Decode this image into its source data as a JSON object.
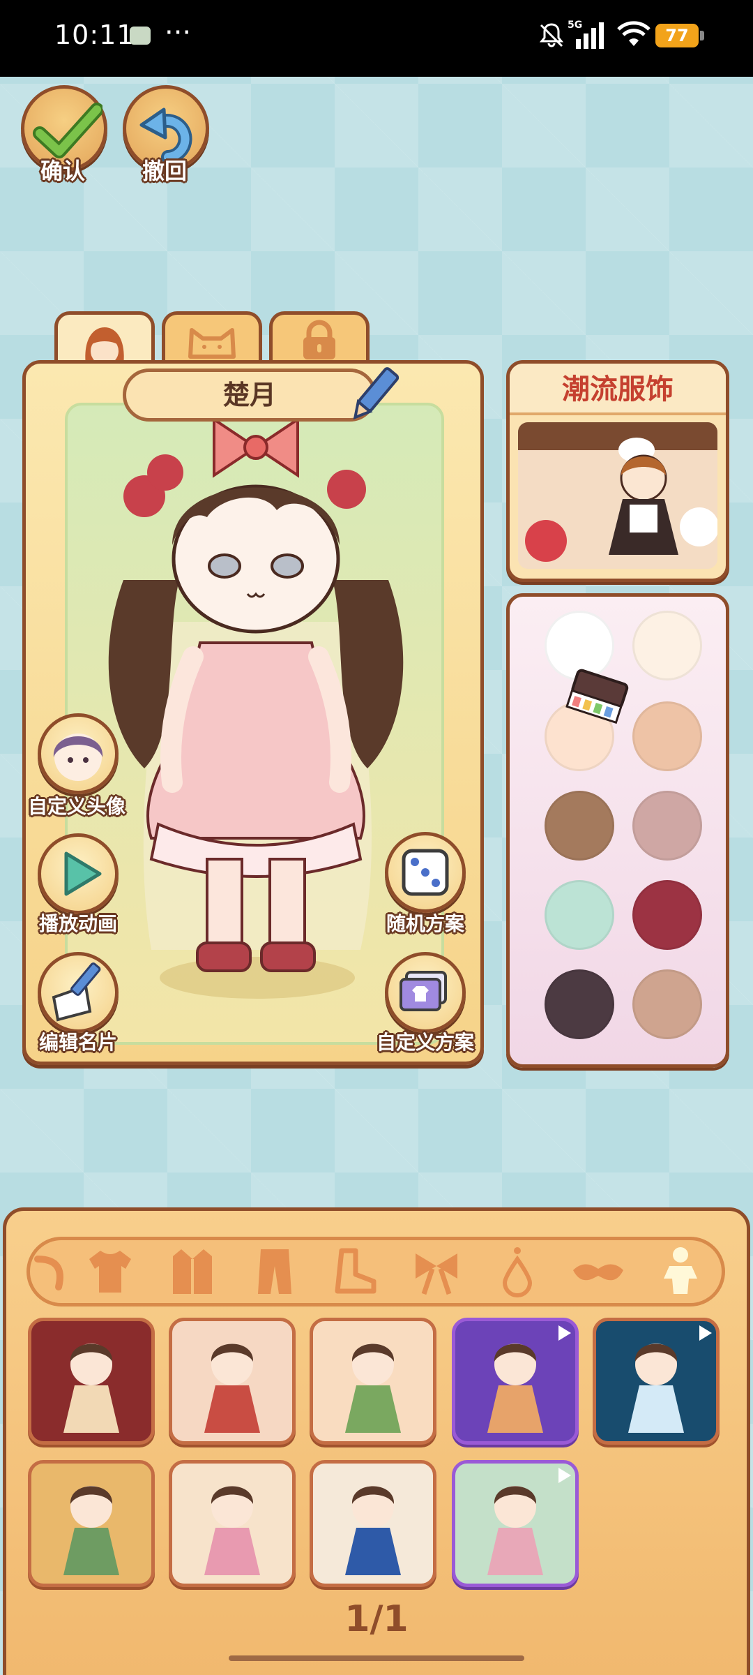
{
  "status_bar": {
    "time": "10:11",
    "network": "5G",
    "battery": "77"
  },
  "top_buttons": {
    "confirm_label": "确认",
    "undo_label": "撤回"
  },
  "tabs": [
    {
      "icon": "face-icon",
      "active": true
    },
    {
      "icon": "cat-icon",
      "active": false
    },
    {
      "icon": "lock-icon",
      "active": false
    }
  ],
  "character": {
    "name": "楚月"
  },
  "side_buttons": {
    "custom_avatar": "自定义头像",
    "play_animation": "播放动画",
    "random_scheme": "随机方案",
    "edit_card": "编辑名片",
    "custom_scheme": "自定义方案"
  },
  "theme_panel": {
    "title": "潮流服饰"
  },
  "palette": {
    "colors": [
      "#ffffff",
      "#fdf1e4",
      "#fde2cf",
      "#eec3a6",
      "#a47a5d",
      "#cfa7a4",
      "#bce3d5",
      "#9c3343",
      "#4c3a42",
      "#cfa48f"
    ]
  },
  "categories": [
    "tail-icon",
    "shirt-icon",
    "coat-icon",
    "pants-icon",
    "shoe-icon",
    "bow-icon",
    "drop-icon",
    "mask-icon",
    "pose-icon"
  ],
  "wardrobe_items": [
    {
      "name": "outfit-1",
      "bg": "#8a2c2c",
      "fg": "#f2d9b5",
      "purple": false,
      "video": false
    },
    {
      "name": "outfit-2",
      "bg": "#f6d8c3",
      "fg": "#c94d43",
      "purple": false,
      "video": false
    },
    {
      "name": "outfit-3",
      "bg": "#f9dcc0",
      "fg": "#7aa860",
      "purple": false,
      "video": false
    },
    {
      "name": "outfit-4",
      "bg": "#6c43b8",
      "fg": "#e7a36a",
      "purple": true,
      "video": true
    },
    {
      "name": "outfit-5",
      "bg": "#184c6e",
      "fg": "#d4eaf7",
      "purple": false,
      "video": true
    },
    {
      "name": "outfit-6",
      "bg": "#e9b86b",
      "fg": "#6e9c62",
      "purple": false,
      "video": false
    },
    {
      "name": "outfit-7",
      "bg": "#f7e3cb",
      "fg": "#e89ab0",
      "purple": false,
      "video": false
    },
    {
      "name": "outfit-8",
      "bg": "#f5e9d9",
      "fg": "#2e5aa8",
      "purple": false,
      "video": false
    },
    {
      "name": "outfit-9",
      "bg": "#c4e0c9",
      "fg": "#e8a8b8",
      "purple": true,
      "video": true
    }
  ],
  "page_indicator": "1/1"
}
